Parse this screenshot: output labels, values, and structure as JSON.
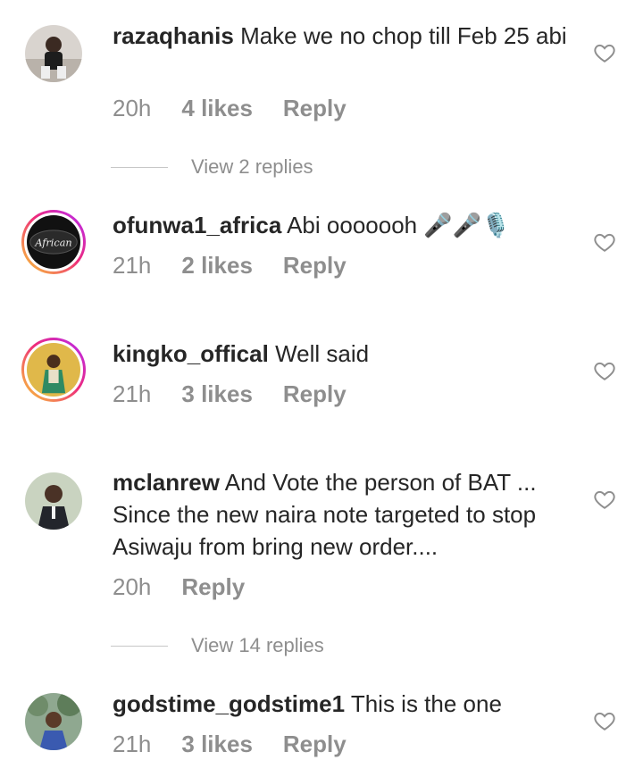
{
  "comments": [
    {
      "username": "razaqhanis",
      "text": "Make we no chop till Feb 25 abi",
      "time": "20h",
      "likes": "4 likes",
      "reply": "Reply",
      "view_replies": "View 2 replies"
    },
    {
      "username": "ofunwa1_africa",
      "text": "Abi ooooooh 🎤🎤🎙️",
      "time": "21h",
      "likes": "2 likes",
      "reply": "Reply",
      "avatar_text": "African"
    },
    {
      "username": "kingko_offical",
      "text": "Well said",
      "time": "21h",
      "likes": "3 likes",
      "reply": "Reply"
    },
    {
      "username": "mclanrew",
      "text": "And Vote the person of BAT ... Since the new naira note targeted to stop Asiwaju from bring new order....",
      "time": "20h",
      "reply": "Reply",
      "view_replies": "View 14 replies"
    },
    {
      "username": "godstime_godstime1",
      "text": "This is the one",
      "time": "21h",
      "likes": "3 likes",
      "reply": "Reply"
    }
  ],
  "icons": {
    "like": "heart-outline-icon"
  },
  "colors": {
    "text": "#262626",
    "muted": "#8e8e8e",
    "ring_start": "#f9ce34",
    "ring_mid": "#ee2a7b",
    "ring_end": "#b429f9"
  }
}
